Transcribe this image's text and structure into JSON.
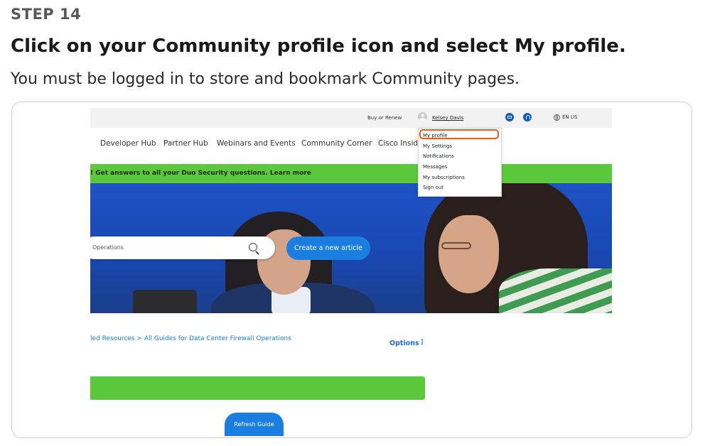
{
  "step": {
    "label": "STEP 14",
    "title": "Click on your Community profile icon and select My profile.",
    "description": "You must be logged in to store and bookmark Community pages."
  },
  "screenshot": {
    "utility_bar": {
      "buy_renew": "Buy or Renew",
      "user_name": "Kelsey Davis",
      "language": "EN US"
    },
    "nav": {
      "items": [
        "Developer Hub",
        "Partner Hub",
        "Webinars and Events",
        "Community Corner",
        "Cisco Inside"
      ]
    },
    "banner": {
      "text": "! Get answers to all your Duo Security questions. Learn more"
    },
    "search": {
      "placeholder": "Operations"
    },
    "create_button": "Create a new article",
    "profile_menu": {
      "items": [
        "My profile",
        "My Settings",
        "Notifications",
        "Messages",
        "My subscriptions",
        "Sign out"
      ],
      "highlighted": "My profile"
    },
    "breadcrumb": "led Resources  >  All Guides for Data Center Firewall Operations",
    "options": "Options",
    "refresh_button": "Refresh Guide",
    "colors": {
      "highlight": "#ee5a24",
      "primary_blue": "#1a7fe0",
      "banner_green": "#5cc83b"
    }
  }
}
